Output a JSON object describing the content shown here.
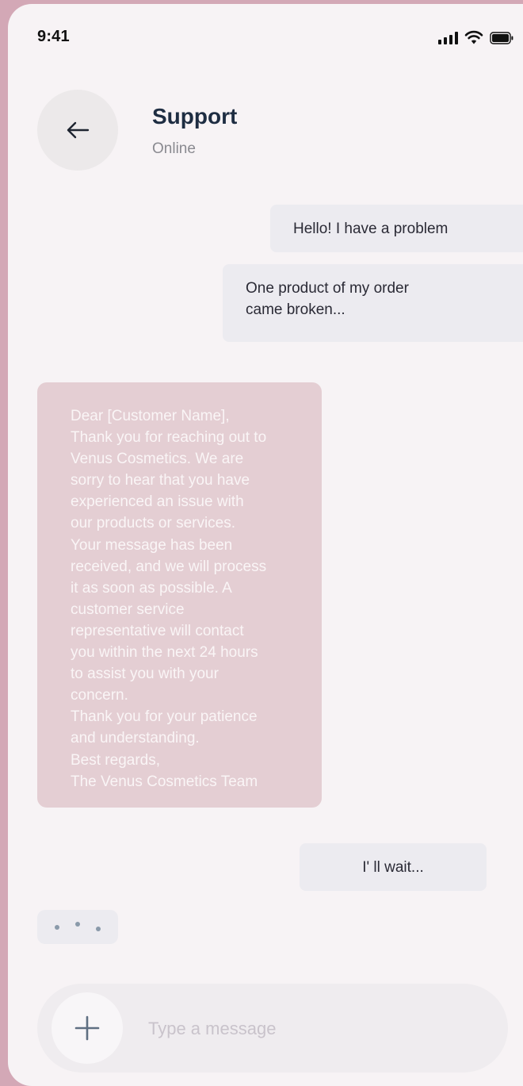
{
  "status_bar": {
    "time": "9:41",
    "icons": [
      "signal-icon",
      "wifi-icon",
      "battery-icon"
    ]
  },
  "header": {
    "back_icon": "arrow-left-icon",
    "title": "Support",
    "status": "Online"
  },
  "messages": [
    {
      "from": "user",
      "text": "Hello! I have a problem"
    },
    {
      "from": "user",
      "lines": [
        "One product of my order",
        "came broken..."
      ]
    },
    {
      "from": "support",
      "lines": [
        "Dear [Customer Name],",
        "Thank you for reaching out to",
        "Venus Cosmetics. We are",
        "sorry to hear that you have",
        "experienced an issue with",
        "our products or services.",
        "Your message has been",
        "received, and we will process",
        "it as soon as possible. A",
        "customer service",
        "representative will contact",
        "you within the next 24 hours",
        "to assist you with your",
        "concern.",
        "Thank you for your patience",
        "and understanding.",
        "Best regards,",
        "The Venus Cosmetics Team"
      ]
    },
    {
      "from": "user",
      "text": "I' ll wait..."
    }
  ],
  "typing_indicator": {
    "dots": 3
  },
  "composer": {
    "add_icon": "plus-icon",
    "placeholder": "Type a message",
    "value": ""
  },
  "colors": {
    "background": "#d3a8b6",
    "screen": "#f7f3f5",
    "user_bubble": "#ecebf0",
    "support_bubble": "#e4ced3",
    "title": "#1e2d42"
  }
}
